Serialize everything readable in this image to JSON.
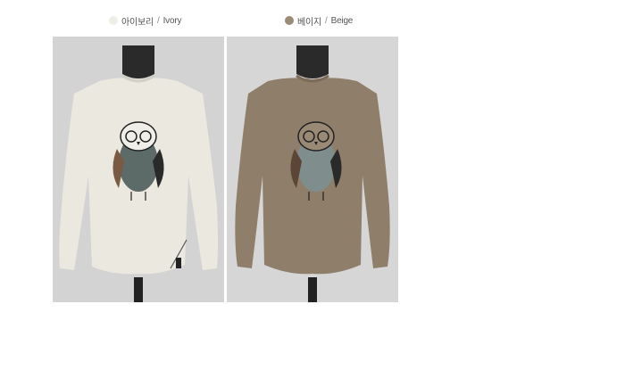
{
  "variants": [
    {
      "label_ko": "아이보리",
      "separator": " / ",
      "label_en": "Ivory",
      "swatch_color": "#efeee7",
      "background": "#d3d3d3",
      "garment_color": "#ebe8df",
      "image_name": "ivory-sweatshirt-image"
    },
    {
      "label_ko": "베이지",
      "separator": " / ",
      "label_en": "Beige",
      "swatch_color": "#9c8c76",
      "background": "#d6d6d6",
      "garment_color": "#8f7e69",
      "image_name": "beige-sweatshirt-image"
    }
  ]
}
